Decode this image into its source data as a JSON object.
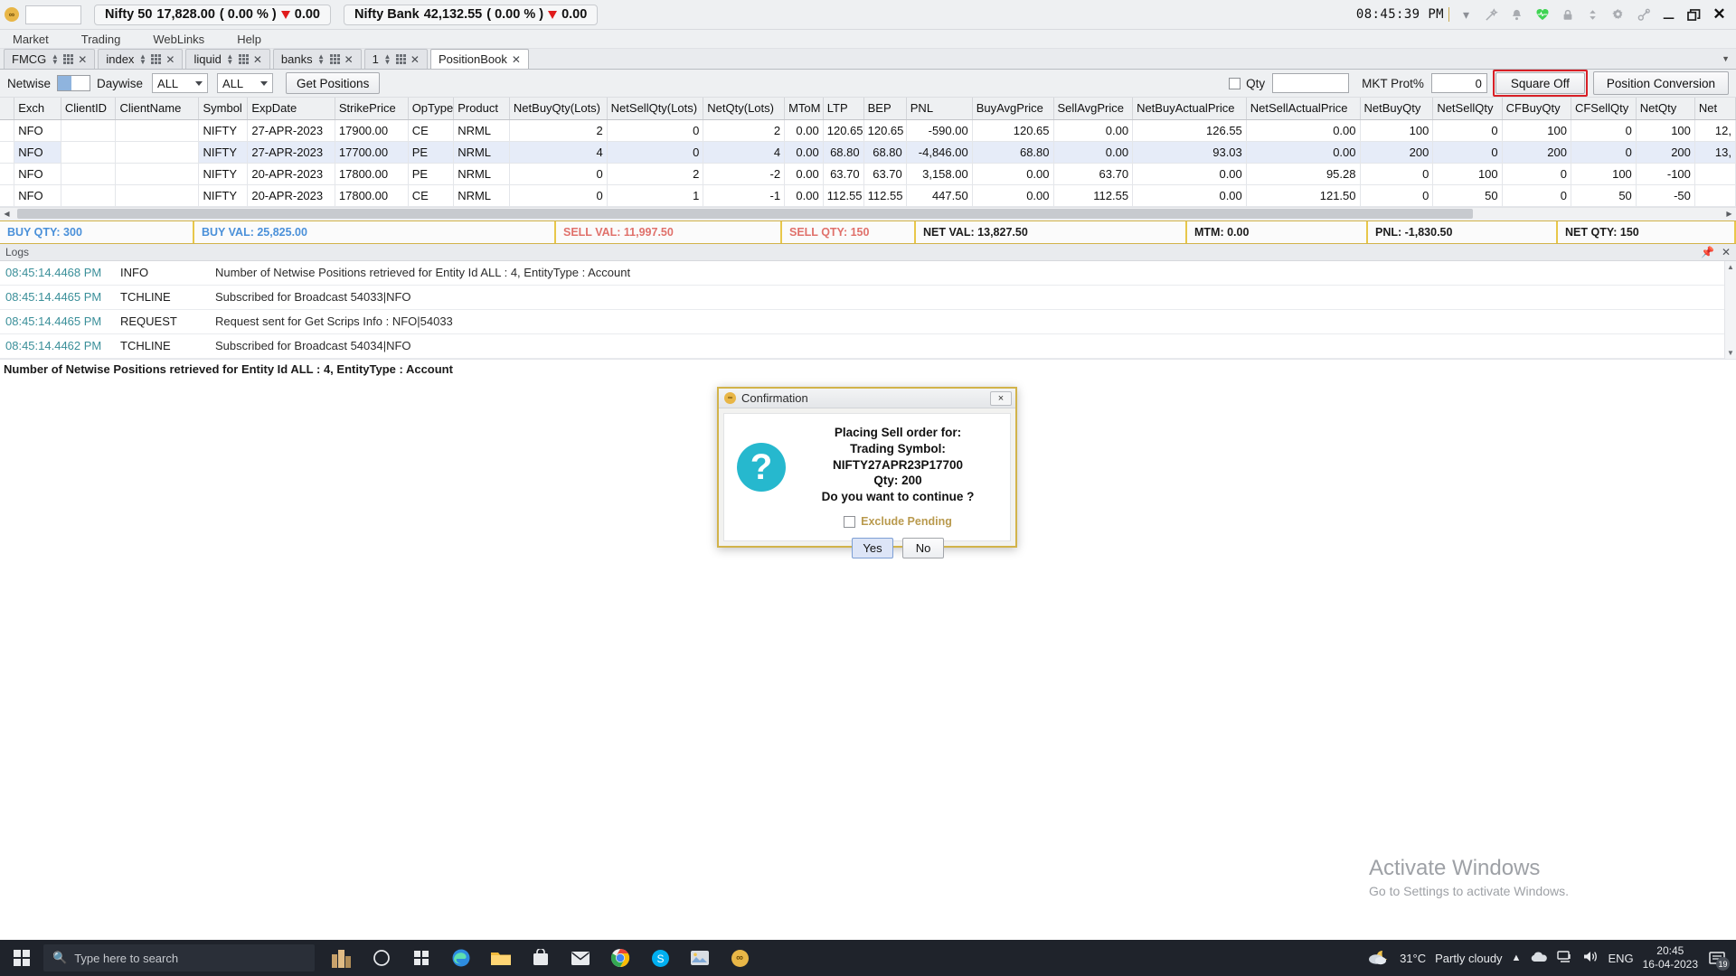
{
  "titlebar": {
    "logo": "infinity-logo",
    "search_value": "",
    "indices": [
      {
        "name": "Nifty 50",
        "value": "17,828.00",
        "pct": "( 0.00 % )",
        "change": "0.00",
        "dir": "down"
      },
      {
        "name": "Nifty Bank",
        "value": "42,132.55",
        "pct": "( 0.00 % )",
        "change": "0.00",
        "dir": "down"
      }
    ],
    "clock": "08:45:39  PM",
    "icons": [
      "caret-down-icon",
      "magic-wand-icon",
      "bell-icon",
      "heartbeat-icon",
      "lock-icon",
      "sort-updown-icon",
      "gear-icon",
      "link-icon",
      "minimize-icon",
      "restore-icon",
      "close-icon"
    ]
  },
  "menubar": {
    "items": [
      "Market",
      "Trading",
      "WebLinks",
      "Help"
    ]
  },
  "tabs": [
    {
      "label": "FMCG",
      "active": false
    },
    {
      "label": "index",
      "active": false
    },
    {
      "label": "liquid",
      "active": false
    },
    {
      "label": "banks",
      "active": false
    },
    {
      "label": "1",
      "active": false
    },
    {
      "label": "PositionBook",
      "active": true
    }
  ],
  "toolbar": {
    "netwise_label": "Netwise",
    "daywise_label": "Daywise",
    "toggle_state": "netwise",
    "filter1": "ALL",
    "filter2": "ALL",
    "get_positions_label": "Get Positions",
    "qty_label": "Qty",
    "qty_checked": false,
    "qty_value": "",
    "mkt_prot_label": "MKT Prot%",
    "mkt_prot_value": "0",
    "square_off_label": "Square Off",
    "position_conversion_label": "Position Conversion"
  },
  "table": {
    "columns": [
      "Exch",
      "ClientID",
      "ClientName",
      "Symbol",
      "ExpDate",
      "StrikePrice",
      "OpType",
      "Product",
      "NetBuyQty(Lots)",
      "NetSellQty(Lots)",
      "NetQty(Lots)",
      "MToM",
      "LTP",
      "BEP",
      "PNL",
      "BuyAvgPrice",
      "SellAvgPrice",
      "NetBuyActualPrice",
      "NetSellActualPrice",
      "NetBuyQty",
      "NetSellQty",
      "CFBuyQty",
      "CFSellQty",
      "NetQty",
      "Net"
    ],
    "rows": [
      {
        "selected": false,
        "cells": [
          "NFO",
          "",
          "",
          "NIFTY",
          "27-APR-2023",
          "17900.00",
          "CE",
          "NRML",
          "2",
          "0",
          "2",
          "0.00",
          "120.65",
          "120.65",
          "-590.00",
          "120.65",
          "0.00",
          "126.55",
          "0.00",
          "100",
          "0",
          "100",
          "0",
          "100",
          "12,"
        ]
      },
      {
        "selected": true,
        "cells": [
          "NFO",
          "",
          "",
          "NIFTY",
          "27-APR-2023",
          "17700.00",
          "PE",
          "NRML",
          "4",
          "0",
          "4",
          "0.00",
          "68.80",
          "68.80",
          "-4,846.00",
          "68.80",
          "0.00",
          "93.03",
          "0.00",
          "200",
          "0",
          "200",
          "0",
          "200",
          "13,"
        ]
      },
      {
        "selected": false,
        "cells": [
          "NFO",
          "",
          "",
          "NIFTY",
          "20-APR-2023",
          "17800.00",
          "PE",
          "NRML",
          "0",
          "2",
          "-2",
          "0.00",
          "63.70",
          "63.70",
          "3,158.00",
          "0.00",
          "63.70",
          "0.00",
          "95.28",
          "0",
          "100",
          "0",
          "100",
          "-100",
          ""
        ]
      },
      {
        "selected": false,
        "cells": [
          "NFO",
          "",
          "",
          "NIFTY",
          "20-APR-2023",
          "17800.00",
          "CE",
          "NRML",
          "0",
          "1",
          "-1",
          "0.00",
          "112.55",
          "112.55",
          "447.50",
          "0.00",
          "112.55",
          "0.00",
          "121.50",
          "0",
          "50",
          "0",
          "50",
          "-50",
          ""
        ]
      }
    ]
  },
  "summary": [
    {
      "label": "BUY QTY: 300",
      "tone": "blue"
    },
    {
      "label": "BUY VAL: 25,825.00",
      "tone": "blue"
    },
    {
      "label": "SELL VAL: 11,997.50",
      "tone": "red"
    },
    {
      "label": "SELL QTY: 150",
      "tone": "red"
    },
    {
      "label": "NET VAL: 13,827.50",
      "tone": "dark"
    },
    {
      "label": "MTM: 0.00",
      "tone": "dark"
    },
    {
      "label": "PNL: -1,830.50",
      "tone": "dark"
    },
    {
      "label": "NET QTY: 150",
      "tone": "dark"
    }
  ],
  "logs": {
    "title": "Logs",
    "entries": [
      {
        "time": "08:45:14.4468 PM",
        "type": "INFO",
        "msg": "Number of Netwise Positions retrieved for Entity Id ALL : 4, EntityType : Account"
      },
      {
        "time": "08:45:14.4465 PM",
        "type": "TCHLINE",
        "msg": "Subscribed for Broadcast 54033|NFO"
      },
      {
        "time": "08:45:14.4465 PM",
        "type": "REQUEST",
        "msg": "Request sent for Get Scrips Info : NFO|54033"
      },
      {
        "time": "08:45:14.4462 PM",
        "type": "TCHLINE",
        "msg": "Subscribed for Broadcast 54034|NFO"
      }
    ],
    "statusline": "Number of Netwise Positions retrieved for Entity Id ALL : 4, EntityType : Account"
  },
  "watermark": {
    "line1": "Activate Windows",
    "line2": "Go to Settings to activate Windows."
  },
  "dialog": {
    "title": "Confirmation",
    "line1": "Placing Sell order for:",
    "line2": "Trading Symbol: NIFTY27APR23P17700",
    "line3": "Qty: 200",
    "line4": "Do you want to continue ?",
    "checkbox_label": "Exclude Pending",
    "checkbox_checked": false,
    "yes_label": "Yes",
    "no_label": "No",
    "close_label": "×"
  },
  "taskbar": {
    "search_placeholder": "Type here to search",
    "weather_temp": "31°C",
    "weather_desc": "Partly cloudy",
    "language": "ENG",
    "time": "20:45",
    "date": "16-04-2023",
    "notification_count": "19"
  },
  "colors": {
    "accent_red": "#d81f26",
    "summary_border": "#e8c74a",
    "selected_row": "#e6ecf8",
    "dialog_border": "#d2b34a",
    "question_icon": "#26b8ce",
    "blue_text": "#4a90d9",
    "red_text": "#e0716b"
  }
}
